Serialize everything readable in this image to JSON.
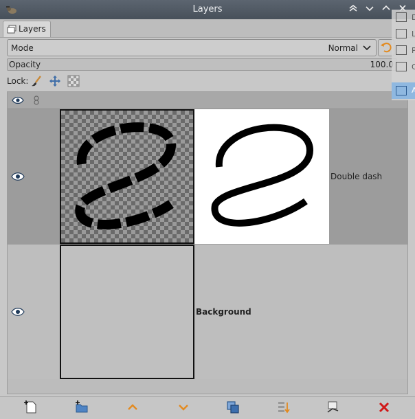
{
  "window": {
    "title": "Layers"
  },
  "tabs": [
    {
      "label": "Layers"
    }
  ],
  "mode": {
    "label": "Mode",
    "value": "Normal"
  },
  "opacity": {
    "label": "Opacity",
    "value": "100.0"
  },
  "lock": {
    "label": "Lock:"
  },
  "layers": [
    {
      "name": "Double dash",
      "visible": true,
      "bold": false
    },
    {
      "name": "Background",
      "visible": true,
      "bold": true
    }
  ],
  "side_panel": {
    "labels": [
      "D",
      "L",
      "P",
      "C",
      "A"
    ]
  },
  "icons": {
    "titlebar": [
      "app-icon",
      "shade-icon",
      "chevron-down-icon",
      "chevron-up-icon",
      "close-icon"
    ],
    "lock": [
      "brush-lock-icon",
      "move-lock-icon",
      "alpha-lock-icon"
    ],
    "bottom": [
      "new-layer-icon",
      "new-group-icon",
      "raise-layer-icon",
      "lower-layer-icon",
      "duplicate-layer-icon",
      "merge-layer-icon",
      "anchor-layer-icon",
      "delete-layer-icon"
    ]
  },
  "colors": {
    "accent_orange": "#e38a1f",
    "delete_red": "#d01818",
    "selection_blue": "#8fb8e0"
  }
}
